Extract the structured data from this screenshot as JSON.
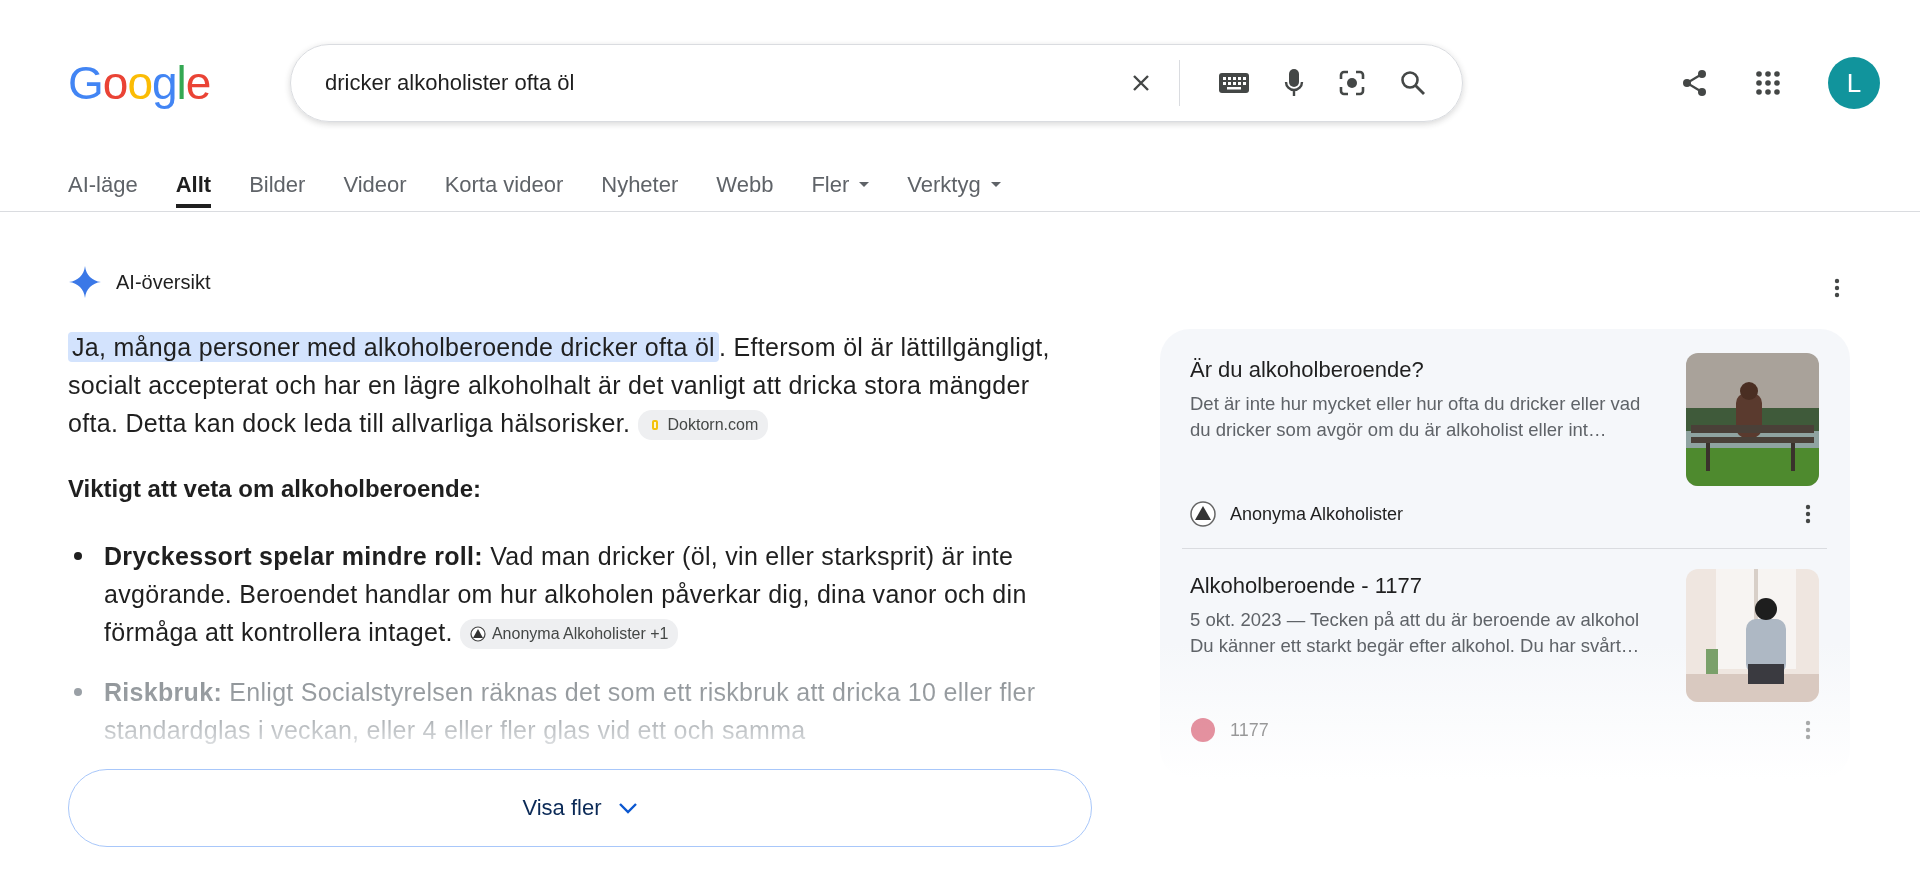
{
  "header": {
    "logo": "Google",
    "search": {
      "value": "dricker alkoholister ofta öl"
    },
    "avatar": "L"
  },
  "tabs": [
    {
      "label": "AI-läge",
      "selected": false,
      "kind": "link"
    },
    {
      "label": "Allt",
      "selected": true,
      "kind": "link"
    },
    {
      "label": "Bilder",
      "selected": false,
      "kind": "link"
    },
    {
      "label": "Videor",
      "selected": false,
      "kind": "link"
    },
    {
      "label": "Korta videor",
      "selected": false,
      "kind": "link"
    },
    {
      "label": "Nyheter",
      "selected": false,
      "kind": "link"
    },
    {
      "label": "Webb",
      "selected": false,
      "kind": "link"
    },
    {
      "label": "Fler",
      "selected": false,
      "kind": "dropdown"
    },
    {
      "label": "Verktyg",
      "selected": false,
      "kind": "dropdown"
    }
  ],
  "overview": {
    "title": "AI-översikt",
    "intro": {
      "segments": [
        {
          "text": "Ja, många personer med alkoholberoende dricker ofta öl",
          "highlighted": true
        },
        {
          "text": ". Eftersom öl är lättillgängligt, socialt accepterat och har en lägre alkoholhalt är det vanligt att dricka stora mängder ofta. Detta kan dock leda till allvarliga hälsorisker.",
          "highlighted": false
        }
      ],
      "source": "Doktorn.com"
    },
    "heading": "Viktigt att veta om alkoholberoende:",
    "bullets": [
      {
        "text": "**Dryckessort spelar mindre roll:** Vad man dricker (öl, vin eller starksprit) är inte avgörande. Beroendet handlar om hur alkoholen påverkar dig, dina vanor och din förmåga att kontrollera intaget.",
        "source": "Anonyma Alkoholister +1",
        "faded": false
      },
      {
        "text": "**Riskbruk:** Enligt Socialstyrelsen räknas det som ett riskbruk att dricka 10 eller fler standardglas i veckan, eller 4 eller fler glas vid ett och samma",
        "faded": true
      }
    ],
    "more_button": "Visa fler"
  },
  "sources": [
    {
      "title": "Är du alkoholberoende?",
      "snippet": "Det är inte hur mycket eller hur ofta du dricker eller vad du dricker som avgör om du är alkoholist eller int…",
      "site": "Anonyma Alkoholister",
      "site_faded": false
    },
    {
      "title": "Alkoholberoende - 1177",
      "snippet": "5 okt. 2023 — Tecken på att du är beroende av alkohol Du känner ett starkt begär efter alkohol. Du har svårt…",
      "site": "1177",
      "site_faded": true
    }
  ]
}
